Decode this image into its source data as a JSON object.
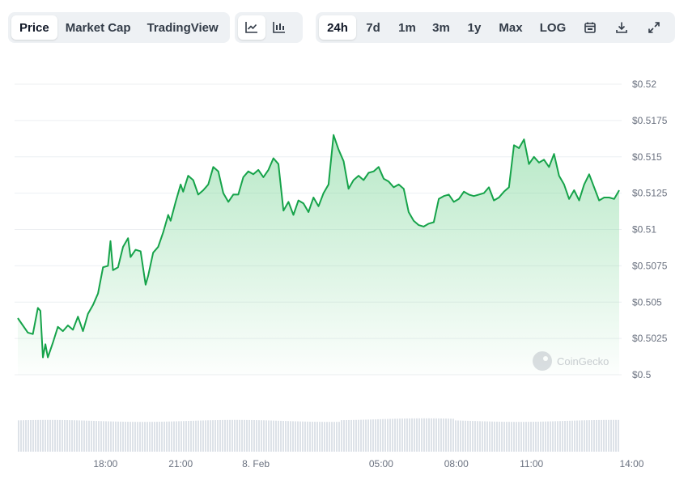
{
  "toolbar": {
    "view_tabs": [
      "Price",
      "Market Cap",
      "TradingView"
    ],
    "active_view": "Price",
    "chart_type_icons": [
      "line-chart-icon",
      "candlestick-chart-icon"
    ],
    "active_chart_type": "line-chart-icon",
    "ranges": [
      "24h",
      "7d",
      "1m",
      "3m",
      "1y",
      "Max"
    ],
    "active_range": "24h",
    "log_label": "LOG",
    "action_icons": [
      "calendar-icon",
      "download-icon",
      "expand-icon"
    ]
  },
  "watermark": "CoinGecko",
  "colors": {
    "line": "#16a34a",
    "fill_top": "#86d9a0",
    "grid": "#eceff2",
    "volume": "#dde2e8",
    "axis_text": "#6b7280",
    "active_tab_bg": "#ffffff",
    "toolbar_bg": "#eef1f4"
  },
  "chart_data": {
    "type": "area",
    "x_tick_labels": [
      "18:00",
      "21:00",
      "8. Feb",
      "05:00",
      "08:00",
      "11:00",
      "14:00"
    ],
    "x_tick_hours": [
      3.5,
      6.5,
      9.5,
      14.5,
      17.5,
      20.5,
      24.5
    ],
    "y_tick_labels": [
      "$0.52",
      "$0.5175",
      "$0.515",
      "$0.5125",
      "$0.51",
      "$0.5075",
      "$0.505",
      "$0.5025",
      "$0.5"
    ],
    "y_tick_values": [
      0.52,
      0.5175,
      0.515,
      0.5125,
      0.51,
      0.5075,
      0.505,
      0.5025,
      0.5
    ],
    "ylim": [
      0.5,
      0.52
    ],
    "x_unit": "hours since chart start",
    "xlim": [
      0,
      24.0
    ],
    "points": [
      [
        0.0,
        0.5039
      ],
      [
        0.2,
        0.5034
      ],
      [
        0.4,
        0.5029
      ],
      [
        0.6,
        0.5028
      ],
      [
        0.8,
        0.5046
      ],
      [
        0.9,
        0.5044
      ],
      [
        1.0,
        0.5012
      ],
      [
        1.1,
        0.5021
      ],
      [
        1.2,
        0.5012
      ],
      [
        1.4,
        0.5022
      ],
      [
        1.6,
        0.5033
      ],
      [
        1.8,
        0.503
      ],
      [
        2.0,
        0.5034
      ],
      [
        2.2,
        0.5031
      ],
      [
        2.4,
        0.504
      ],
      [
        2.6,
        0.503
      ],
      [
        2.8,
        0.5042
      ],
      [
        3.0,
        0.5048
      ],
      [
        3.2,
        0.5056
      ],
      [
        3.4,
        0.5074
      ],
      [
        3.6,
        0.5075
      ],
      [
        3.7,
        0.5092
      ],
      [
        3.8,
        0.5072
      ],
      [
        4.0,
        0.5074
      ],
      [
        4.2,
        0.5088
      ],
      [
        4.4,
        0.5094
      ],
      [
        4.5,
        0.5081
      ],
      [
        4.7,
        0.5086
      ],
      [
        4.9,
        0.5085
      ],
      [
        5.1,
        0.5062
      ],
      [
        5.2,
        0.5068
      ],
      [
        5.4,
        0.5084
      ],
      [
        5.6,
        0.5088
      ],
      [
        5.8,
        0.5098
      ],
      [
        6.0,
        0.511
      ],
      [
        6.1,
        0.5106
      ],
      [
        6.3,
        0.5119
      ],
      [
        6.5,
        0.5131
      ],
      [
        6.6,
        0.5126
      ],
      [
        6.8,
        0.5137
      ],
      [
        7.0,
        0.5134
      ],
      [
        7.2,
        0.5124
      ],
      [
        7.4,
        0.5127
      ],
      [
        7.6,
        0.5131
      ],
      [
        7.8,
        0.5143
      ],
      [
        8.0,
        0.514
      ],
      [
        8.2,
        0.5125
      ],
      [
        8.4,
        0.5119
      ],
      [
        8.6,
        0.5124
      ],
      [
        8.8,
        0.5124
      ],
      [
        9.0,
        0.5136
      ],
      [
        9.2,
        0.514
      ],
      [
        9.4,
        0.5138
      ],
      [
        9.6,
        0.5141
      ],
      [
        9.8,
        0.5136
      ],
      [
        10.0,
        0.5141
      ],
      [
        10.2,
        0.5149
      ],
      [
        10.4,
        0.5145
      ],
      [
        10.6,
        0.5113
      ],
      [
        10.8,
        0.5119
      ],
      [
        11.0,
        0.511
      ],
      [
        11.2,
        0.512
      ],
      [
        11.4,
        0.5118
      ],
      [
        11.6,
        0.5112
      ],
      [
        11.8,
        0.5122
      ],
      [
        12.0,
        0.5116
      ],
      [
        12.2,
        0.5125
      ],
      [
        12.4,
        0.5131
      ],
      [
        12.6,
        0.5165
      ],
      [
        12.8,
        0.5155
      ],
      [
        13.0,
        0.5147
      ],
      [
        13.2,
        0.5128
      ],
      [
        13.4,
        0.5134
      ],
      [
        13.6,
        0.5137
      ],
      [
        13.8,
        0.5134
      ],
      [
        14.0,
        0.5139
      ],
      [
        14.2,
        0.514
      ],
      [
        14.4,
        0.5143
      ],
      [
        14.6,
        0.5135
      ],
      [
        14.8,
        0.5133
      ],
      [
        15.0,
        0.5129
      ],
      [
        15.2,
        0.5131
      ],
      [
        15.4,
        0.5128
      ],
      [
        15.6,
        0.5112
      ],
      [
        15.8,
        0.5106
      ],
      [
        16.0,
        0.5103
      ],
      [
        16.2,
        0.5102
      ],
      [
        16.4,
        0.5104
      ],
      [
        16.6,
        0.5105
      ],
      [
        16.8,
        0.5121
      ],
      [
        17.0,
        0.5123
      ],
      [
        17.2,
        0.5124
      ],
      [
        17.4,
        0.5119
      ],
      [
        17.6,
        0.5121
      ],
      [
        17.8,
        0.5126
      ],
      [
        18.0,
        0.5124
      ],
      [
        18.2,
        0.5123
      ],
      [
        18.4,
        0.5124
      ],
      [
        18.6,
        0.5125
      ],
      [
        18.8,
        0.5129
      ],
      [
        19.0,
        0.512
      ],
      [
        19.2,
        0.5122
      ],
      [
        19.4,
        0.5126
      ],
      [
        19.6,
        0.5129
      ],
      [
        19.8,
        0.5158
      ],
      [
        20.0,
        0.5156
      ],
      [
        20.2,
        0.5162
      ],
      [
        20.4,
        0.5145
      ],
      [
        20.6,
        0.515
      ],
      [
        20.8,
        0.5146
      ],
      [
        21.0,
        0.5148
      ],
      [
        21.2,
        0.5143
      ],
      [
        21.4,
        0.5152
      ],
      [
        21.6,
        0.5137
      ],
      [
        21.8,
        0.5131
      ],
      [
        22.0,
        0.5121
      ],
      [
        22.2,
        0.5127
      ],
      [
        22.4,
        0.512
      ],
      [
        22.6,
        0.5131
      ],
      [
        22.8,
        0.5138
      ],
      [
        23.0,
        0.5129
      ],
      [
        23.2,
        0.512
      ],
      [
        23.4,
        0.5122
      ],
      [
        23.6,
        0.5122
      ],
      [
        23.8,
        0.5121
      ],
      [
        24.0,
        0.5127
      ]
    ],
    "volume_series": "flat low bars under chart",
    "grid": true
  }
}
